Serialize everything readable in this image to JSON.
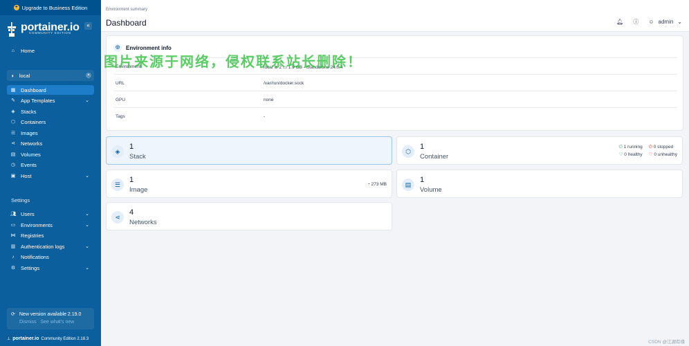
{
  "sidebar": {
    "upgrade_label": "Upgrade to Business Edition",
    "brand_name": "portainer.io",
    "brand_edition": "COMMUNITY EDITION",
    "home_label": "Home",
    "env_name": "local",
    "items": [
      {
        "label": "Dashboard",
        "icon": "dashboard-icon"
      },
      {
        "label": "App Templates",
        "icon": "edit-icon"
      },
      {
        "label": "Stacks",
        "icon": "layers-icon"
      },
      {
        "label": "Containers",
        "icon": "box-icon"
      },
      {
        "label": "Images",
        "icon": "list-icon"
      },
      {
        "label": "Networks",
        "icon": "share-icon"
      },
      {
        "label": "Volumes",
        "icon": "database-icon"
      },
      {
        "label": "Events",
        "icon": "clock-icon"
      },
      {
        "label": "Host",
        "icon": "server-icon"
      }
    ],
    "settings_label": "Settings",
    "settings_items": [
      {
        "label": "Users"
      },
      {
        "label": "Environments"
      },
      {
        "label": "Registries"
      },
      {
        "label": "Authentication logs"
      },
      {
        "label": "Notifications"
      },
      {
        "label": "Settings"
      }
    ],
    "update_text": "New version available 2.19.0",
    "dismiss_label": "Dismiss",
    "see_new_label": "See what's new",
    "footer_brand": "portainer.io",
    "footer_version": "Community Edition 2.18.3"
  },
  "header": {
    "breadcrumb": "Environment summary",
    "title": "Dashboard",
    "username": "admin"
  },
  "env_info": {
    "title": "Environment info",
    "rows": [
      {
        "key": "Environment",
        "value": "local ⊚ 2 ▭ 1.9 GB - Standalone 24.0.4"
      },
      {
        "key": "URL",
        "value": "/var/run/docker.sock"
      },
      {
        "key": "GPU",
        "value": "none"
      },
      {
        "key": "Tags",
        "value": "-"
      }
    ]
  },
  "tiles": {
    "stack": {
      "count": "1",
      "label": "Stack"
    },
    "container": {
      "count": "1",
      "label": "Container",
      "running": "1 running",
      "stopped": "0 stopped",
      "healthy": "0 healthy",
      "unhealthy": "0 unhealthy"
    },
    "image": {
      "count": "1",
      "label": "Image",
      "size": "273 MB"
    },
    "volume": {
      "count": "1",
      "label": "Volume"
    },
    "networks": {
      "count": "4",
      "label": "Networks"
    }
  },
  "overlay": {
    "watermark": "图片来源于网络，侵权联系站长删除！",
    "csdn": "CSDN @江湖有缘"
  }
}
